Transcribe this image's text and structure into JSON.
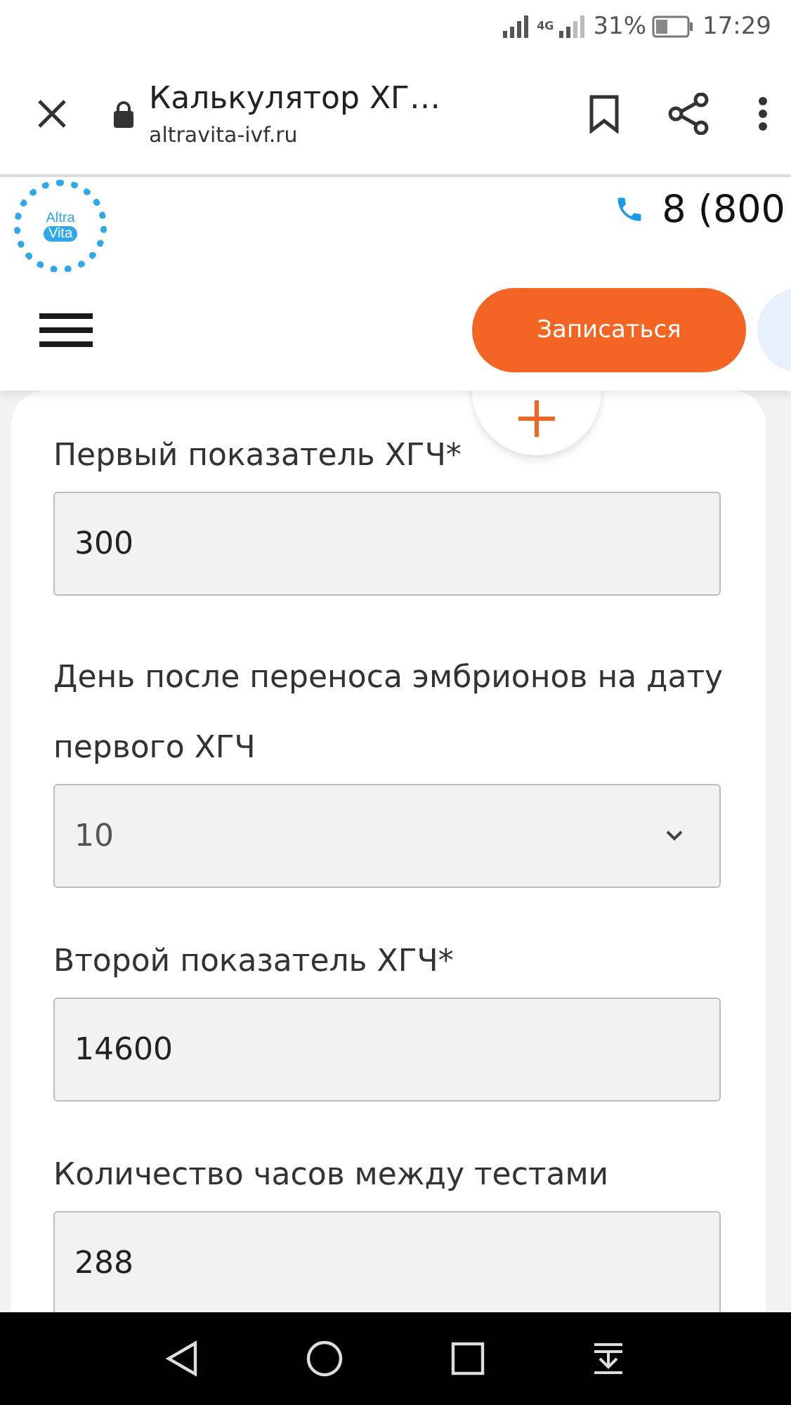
{
  "status_bar": {
    "network": "4G",
    "battery": "31%",
    "time": "17:29"
  },
  "browser": {
    "title": "Калькулятор ХГ…",
    "url": "altravita-ivf.ru"
  },
  "site_header": {
    "logo": [
      "Altra",
      "Vita"
    ],
    "phone": "8 (800",
    "cta": "Записаться"
  },
  "form": {
    "fields": [
      {
        "kind": "input",
        "label": "Первый показатель ХГЧ*",
        "value": "300"
      },
      {
        "kind": "select",
        "label": "День после переноса эмбрионов на дату первого ХГЧ",
        "value": "10"
      },
      {
        "kind": "input",
        "label": "Второй показатель ХГЧ*",
        "value": "14600"
      },
      {
        "kind": "input",
        "label": "Количество часов между тестами",
        "value": "288"
      }
    ]
  }
}
